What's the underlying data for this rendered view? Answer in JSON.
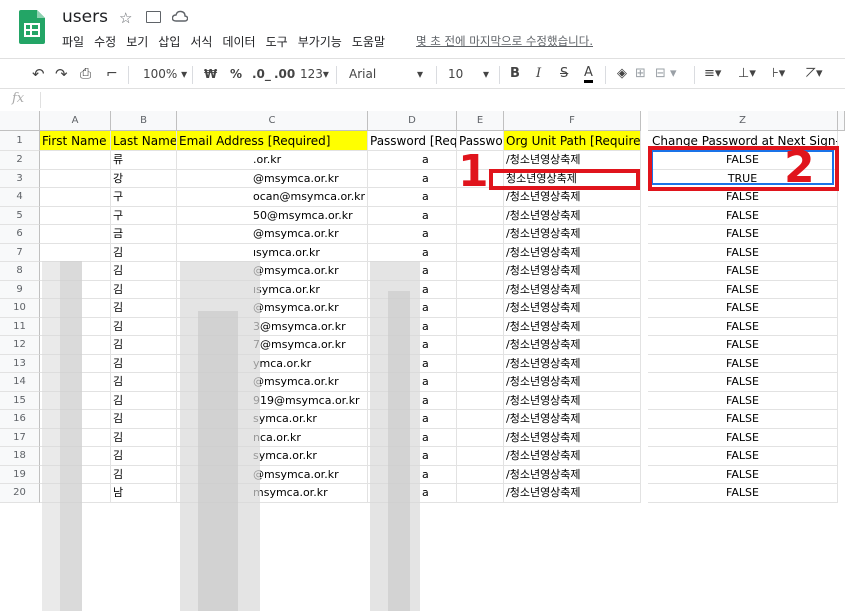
{
  "app": {
    "title": "users",
    "menu": [
      "파일",
      "수정",
      "보기",
      "삽입",
      "서식",
      "데이터",
      "도구",
      "부가기능",
      "도움말"
    ],
    "last_edit": "몇 초 전에 마지막으로 수정했습니다."
  },
  "toolbar": {
    "zoom": "100%",
    "currency": "₩",
    "percent": "%",
    "dec_decrease": ".0_",
    "dec_increase": ".00",
    "more_formats": "123▾",
    "font": "Arial",
    "font_size": "10",
    "bold": "B",
    "italic": "I",
    "strike": "S",
    "text_color": "A"
  },
  "formula_bar": {
    "label": "fx",
    "value": ""
  },
  "columns": [
    "A",
    "B",
    "C",
    "D",
    "E",
    "F",
    "Z"
  ],
  "row_numbers": [
    "1",
    "2",
    "3",
    "4",
    "5",
    "6",
    "7",
    "8",
    "9",
    "10",
    "11",
    "12",
    "13",
    "14",
    "15",
    "16",
    "17",
    "18",
    "19",
    "20"
  ],
  "headers": {
    "A": "First Name [Required]",
    "B": "Last Name [Required]",
    "C": "Email Address [Required]",
    "D": "Password [Required]",
    "E": "Password Hash Function",
    "F": "Org Unit Path [Required]",
    "Z": "Change Password at Next Sign-In"
  },
  "last_names": [
    "류",
    "강",
    "구",
    "구",
    "금",
    "김",
    "김",
    "김",
    "김",
    "김",
    "김",
    "김",
    "김",
    "김",
    "김",
    "김",
    "김",
    "김",
    "남"
  ],
  "email_fragments": [
    ".or.kr",
    "@msymca.or.kr",
    "ocan@msymca.or.kr",
    "50@msymca.or.kr",
    "@msymca.or.kr",
    "ısymca.or.kr",
    "@msymca.or.kr",
    "ısymca.or.kr",
    "@msymca.or.kr",
    "3@msymca.or.kr",
    "7@msymca.or.kr",
    "ymca.or.kr",
    "@msymca.or.kr",
    "919@msymca.or.kr",
    "symca.or.kr",
    "nca.or.kr",
    "symca.or.kr",
    "@msymca.or.kr",
    "msymca.or.kr"
  ],
  "password_fragment": "a",
  "org_unit_paths": [
    "/청소년영상축제",
    "청소년영상축제",
    "/청소년영상축제",
    "/청소년영상축제",
    "/청소년영상축제",
    "/청소년영상축제",
    "/청소년영상축제",
    "/청소년영상축제",
    "/청소년영상축제",
    "/청소년영상축제",
    "/청소년영상축제",
    "/청소년영상축제",
    "/청소년영상축제",
    "/청소년영상축제",
    "/청소년영상축제",
    "/청소년영상축제",
    "/청소년영상축제",
    "/청소년영상축제",
    "/청소년영상축제"
  ],
  "change_password": [
    "FALSE",
    "TRUE",
    "FALSE",
    "FALSE",
    "FALSE",
    "FALSE",
    "FALSE",
    "FALSE",
    "FALSE",
    "FALSE",
    "FALSE",
    "FALSE",
    "FALSE",
    "FALSE",
    "FALSE",
    "FALSE",
    "FALSE",
    "FALSE",
    "FALSE"
  ],
  "annotations": {
    "one": "1",
    "two": "2",
    "color": "#e0141c"
  }
}
